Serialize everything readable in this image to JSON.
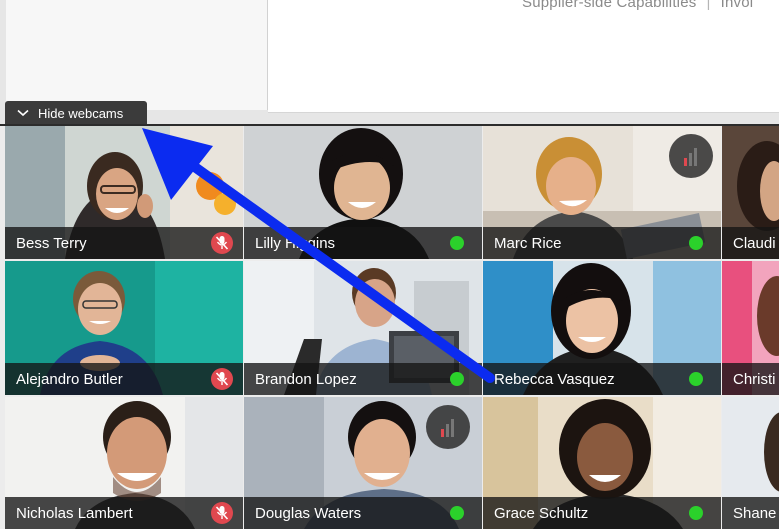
{
  "slide": {
    "header_left": "Supplier-side Capabilities",
    "header_sep": "|",
    "header_right": "Invoi"
  },
  "toolbar": {
    "hide_webcams_label": "Hide webcams"
  },
  "participants": [
    {
      "name": "Bess Terry",
      "status": "muted"
    },
    {
      "name": "Lilly Higgins",
      "status": "online"
    },
    {
      "name": "Marc Rice",
      "status": "online"
    },
    {
      "name": "Claudi",
      "status": "online"
    },
    {
      "name": "Alejandro Butler",
      "status": "muted"
    },
    {
      "name": "Brandon Lopez",
      "status": "online"
    },
    {
      "name": "Rebecca Vasquez",
      "status": "online"
    },
    {
      "name": "Christi",
      "status": "online"
    },
    {
      "name": "Nicholas Lambert",
      "status": "muted"
    },
    {
      "name": "Douglas Waters",
      "status": "online"
    },
    {
      "name": "Grace Schultz",
      "status": "online"
    },
    {
      "name": "Shane",
      "status": "online"
    }
  ],
  "colors": {
    "online": "#2bd12b",
    "muted": "#e0484f",
    "arrow": "#0b2bf0",
    "signal_bar": "#e0484f"
  },
  "icons": {
    "hide_tab": "chevron-down-icon",
    "muted": "mic-muted-icon",
    "online": "online-status-icon",
    "signal": "signal-strength-icon",
    "annotation": "arrow-icon"
  }
}
